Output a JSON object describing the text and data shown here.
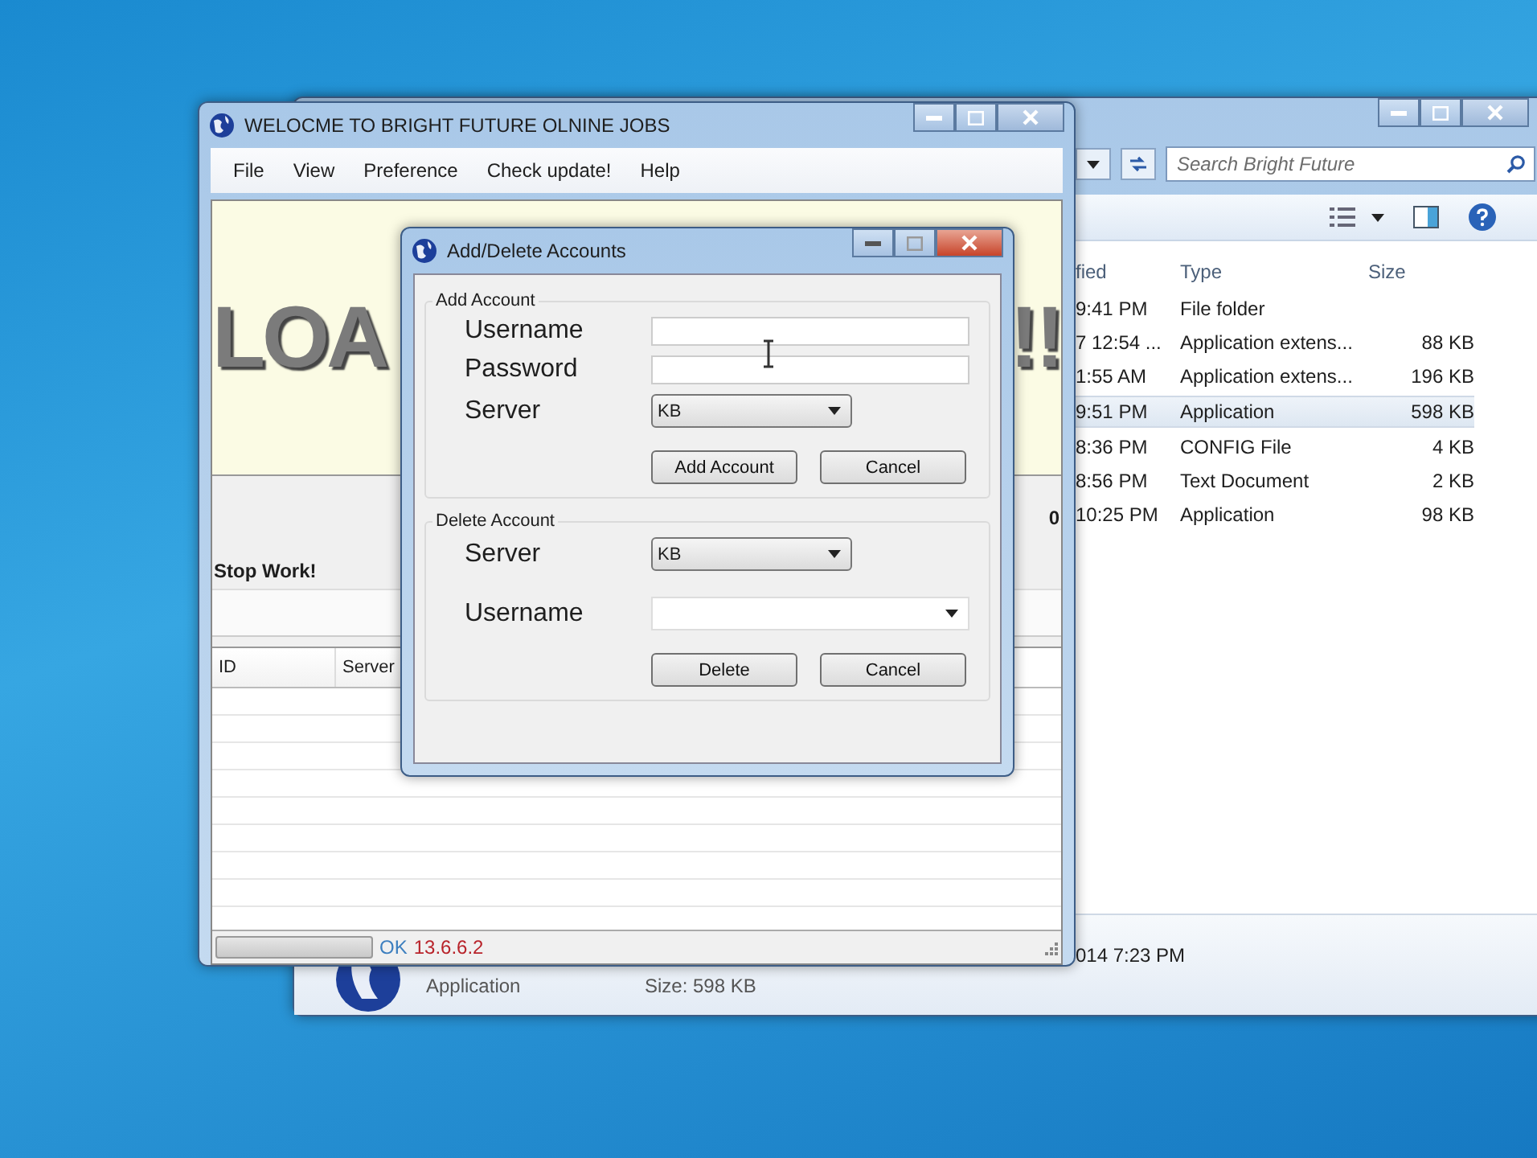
{
  "explorer": {
    "search": {
      "placeholder": "Search Bright Future"
    },
    "columns": [
      "fied",
      "Type",
      "Size"
    ],
    "rows": [
      {
        "modified": "9:41 PM",
        "type": "File folder",
        "selected": false
      },
      {
        "modified": "7 12:54 ...",
        "type": "Application extens...",
        "size": "88 KB",
        "selected": false
      },
      {
        "modified": "1:55 AM",
        "type": "Application extens...",
        "size": "196 KB",
        "selected": false
      },
      {
        "modified": "9:51 PM",
        "type": "Application",
        "size": "598 KB",
        "selected": true
      },
      {
        "modified": "8:36 PM",
        "type": "CONFIG File",
        "size": "4 KB",
        "selected": false
      },
      {
        "modified": "8:56 PM",
        "type": "Text Document",
        "size": "2 KB",
        "selected": false
      },
      {
        "modified": "10:25 PM",
        "type": "Application",
        "size": "98 KB",
        "selected": false
      }
    ],
    "details": {
      "date": "014 7:23 PM",
      "type": "Application",
      "size": "Size: 598 KB"
    }
  },
  "main_window": {
    "title": "WELOCME TO BRIGHT FUTURE OLNINE JOBS",
    "menu": [
      "File",
      "View",
      "Preference",
      "Check update!",
      "Help"
    ],
    "banner": {
      "left_text": "LOA",
      "right_text": "!!"
    },
    "stop_label": "Stop Work!",
    "counter": "0",
    "table": {
      "columns": [
        "ID",
        "Server"
      ]
    },
    "status_bar": {
      "progress": {
        "level": 0
      },
      "status": "OK",
      "version": "13.6.6.2"
    }
  },
  "dialog": {
    "title": "Add/Delete Accounts",
    "add_group": {
      "title": "Add Account",
      "username_label": "Username",
      "password_label": "Password",
      "server_label": "Server",
      "server_value": "KB",
      "buttons": [
        "Add Account",
        "Cancel"
      ]
    },
    "delete_group": {
      "title": "Delete Account",
      "server_label": "Server",
      "server_value": "KB",
      "username_label": "Username",
      "buttons": [
        "Delete",
        "Cancel"
      ]
    }
  }
}
